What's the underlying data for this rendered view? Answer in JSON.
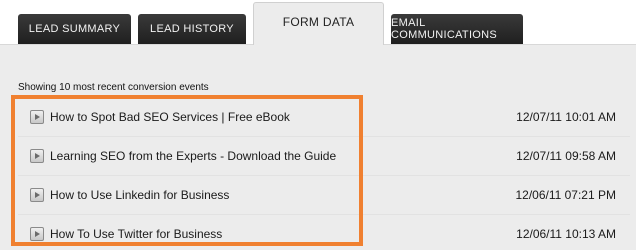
{
  "tabs": [
    {
      "label": "LEAD SUMMARY",
      "active": false
    },
    {
      "label": "LEAD HISTORY",
      "active": false
    },
    {
      "label": "FORM DATA",
      "active": true
    },
    {
      "label": "EMAIL COMMUNICATIONS",
      "active": false
    }
  ],
  "caption": "Showing 10 most recent conversion events",
  "events": [
    {
      "title": "How to Spot Bad SEO Services | Free eBook",
      "timestamp": "12/07/11 10:01 AM"
    },
    {
      "title": "Learning SEO from the Experts - Download the Guide",
      "timestamp": "12/07/11 09:58 AM"
    },
    {
      "title": "How to Use Linkedin for Business",
      "timestamp": "12/06/11 07:21 PM"
    },
    {
      "title": "How To Use Twitter for Business",
      "timestamp": "12/06/11 10:13 AM"
    }
  ],
  "icons": {
    "row_icon": "play-icon"
  },
  "colors": {
    "highlight": "#f08030",
    "tab_dark": "#2a2a2a",
    "panel": "#ececec"
  }
}
